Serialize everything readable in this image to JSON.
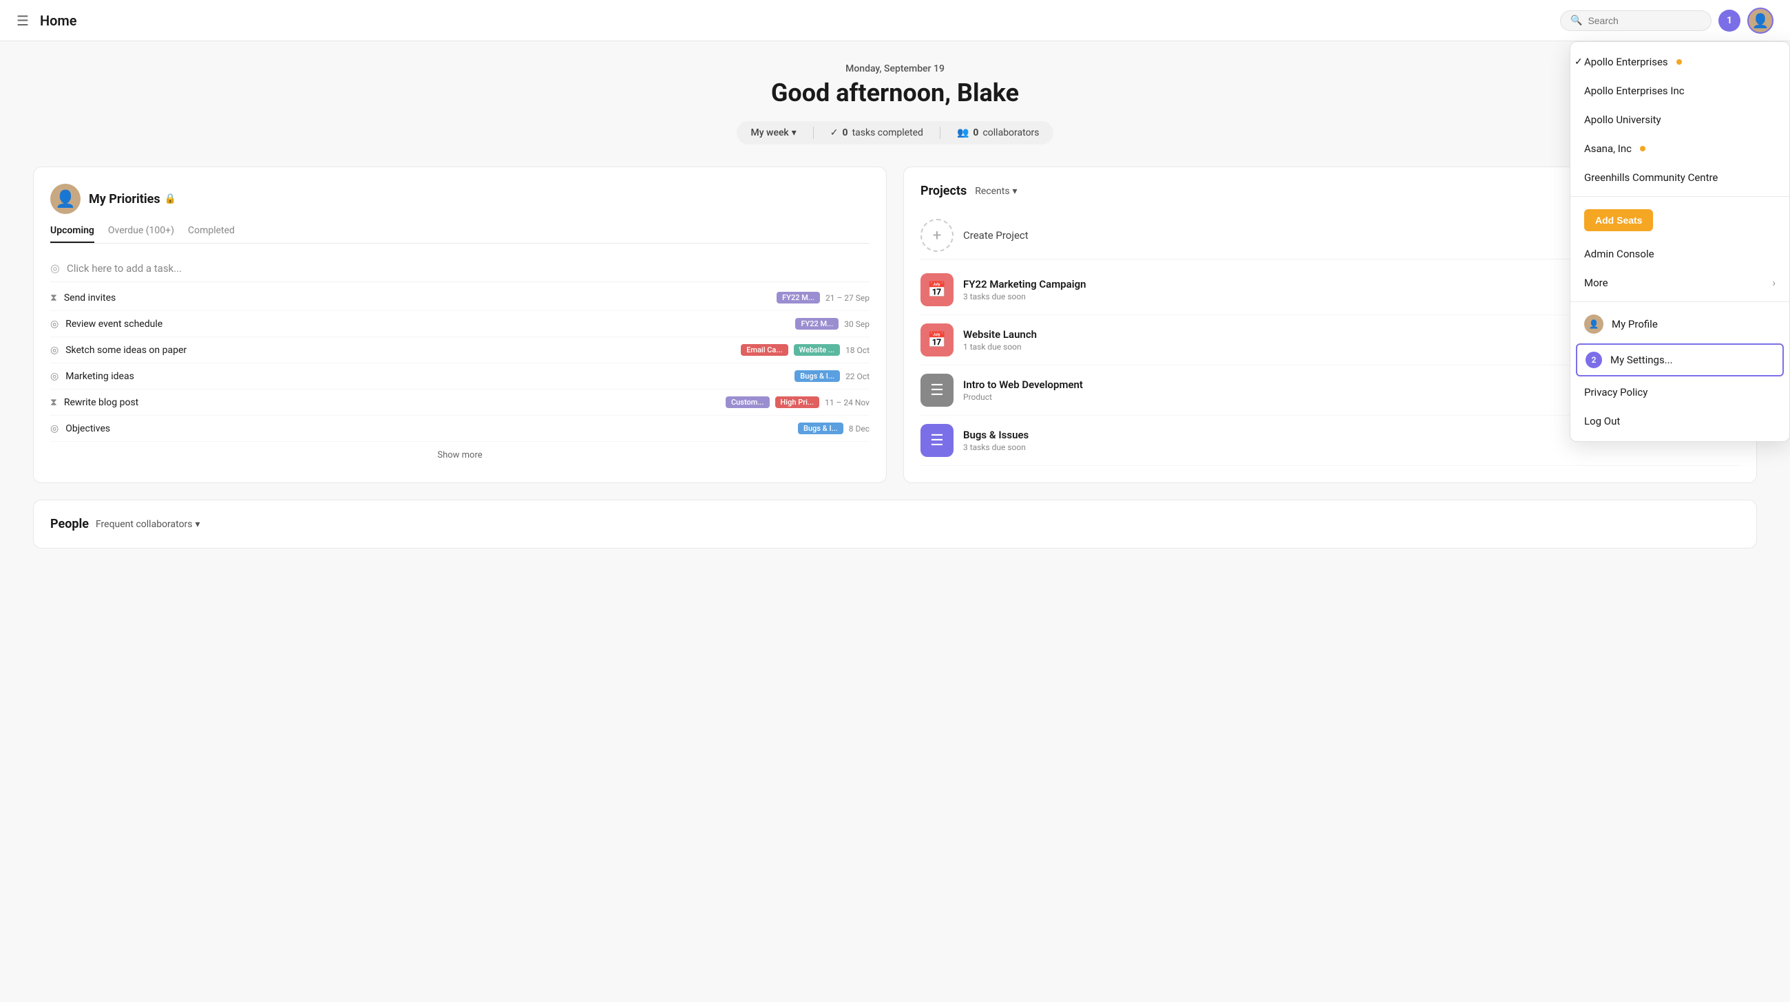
{
  "nav": {
    "title": "Home",
    "search_placeholder": "Search",
    "notif_count": "1"
  },
  "greeting": {
    "date": "Monday, September 19",
    "message": "Good afternoon, Blake",
    "week_label": "My week",
    "tasks_completed": "0",
    "tasks_label": "tasks completed",
    "collaborators_count": "0",
    "collaborators_label": "collaborators"
  },
  "priorities": {
    "section_title": "My Priorities",
    "tabs": [
      "Upcoming",
      "Overdue (100+)",
      "Completed"
    ],
    "active_tab": "Upcoming",
    "add_task_placeholder": "Click here to add a task...",
    "tasks": [
      {
        "name": "Send invites",
        "icon": "hourglass",
        "tags": [
          {
            "label": "FY22 M...",
            "color": "purple"
          }
        ],
        "date": "21 – 27 Sep"
      },
      {
        "name": "Review event schedule",
        "icon": "check-circle",
        "tags": [
          {
            "label": "FY22 M...",
            "color": "purple"
          }
        ],
        "date": "30 Sep"
      },
      {
        "name": "Sketch some ideas on paper",
        "icon": "check-circle",
        "tags": [
          {
            "label": "Email Ca...",
            "color": "red"
          },
          {
            "label": "Website ...",
            "color": "teal"
          }
        ],
        "date": "18 Oct"
      },
      {
        "name": "Marketing ideas",
        "icon": "check-circle",
        "tags": [
          {
            "label": "Bugs & I...",
            "color": "blue"
          }
        ],
        "date": "22 Oct"
      },
      {
        "name": "Rewrite blog post",
        "icon": "hourglass",
        "tags": [
          {
            "label": "Custom...",
            "color": "purple"
          },
          {
            "label": "High Pri...",
            "color": "red"
          }
        ],
        "date": "11 – 24 Nov"
      },
      {
        "name": "Objectives",
        "icon": "check-circle",
        "tags": [
          {
            "label": "Bugs & I...",
            "color": "blue"
          }
        ],
        "date": "8 Dec"
      }
    ],
    "show_more_label": "Show more"
  },
  "projects": {
    "section_title": "Projects",
    "filter_label": "Recents",
    "create_label": "Create Project",
    "items": [
      {
        "name": "FY22 Marketing Campaign",
        "sub": "3 tasks due soon",
        "icon": "📅",
        "color": "pink"
      },
      {
        "name": "Website Launch",
        "sub": "1 task due soon",
        "icon": "📅",
        "color": "pink"
      },
      {
        "name": "Intro to Web Development",
        "sub": "Product",
        "icon": "☰",
        "color": "gray"
      },
      {
        "name": "Bugs & Issues",
        "sub": "3 tasks due soon",
        "icon": "☰",
        "color": "purple"
      }
    ]
  },
  "people": {
    "section_title": "People",
    "filter_label": "Frequent collaborators"
  },
  "dropdown": {
    "orgs": [
      {
        "name": "Apollo Enterprises",
        "dot": true,
        "checked": true
      },
      {
        "name": "Apollo Enterprises Inc",
        "dot": false,
        "checked": false
      },
      {
        "name": "Apollo University",
        "dot": false,
        "checked": false
      },
      {
        "name": "Asana, Inc",
        "dot": true,
        "checked": false
      },
      {
        "name": "Greenhills Community Centre",
        "dot": false,
        "checked": false
      }
    ],
    "add_seats_label": "Add Seats",
    "admin_console_label": "Admin Console",
    "more_label": "More",
    "my_profile_label": "My Profile",
    "my_settings_label": "My Settings...",
    "privacy_policy_label": "Privacy Policy",
    "log_out_label": "Log Out"
  }
}
